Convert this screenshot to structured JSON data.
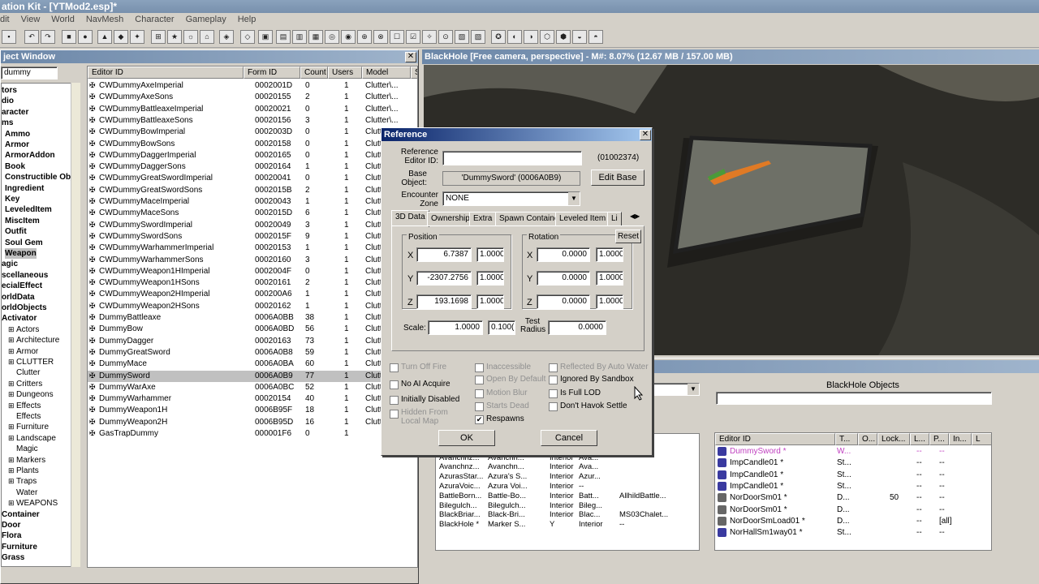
{
  "app": {
    "title": "ation Kit - [YTMod2.esp]*"
  },
  "menu": [
    "dit",
    "View",
    "World",
    "NavMesh",
    "Character",
    "Gameplay",
    "Help"
  ],
  "object_window": {
    "title": "ject Window",
    "filter": "dummy",
    "tree": [
      "tors",
      "dio",
      "aracter",
      "ms",
      "Ammo",
      "Armor",
      "ArmorAddon",
      "Book",
      "Constructible Obj",
      "Ingredient",
      "Key",
      "LeveledItem",
      "MiscItem",
      "Outfit",
      "Soul Gem",
      "Weapon",
      "agic",
      "scellaneous",
      "ecialEffect",
      "orldData",
      "orldObjects",
      "Activator",
      "Actors",
      "Architecture",
      "Armor",
      "CLUTTER",
      "Clutter",
      "Critters",
      "Dungeons",
      "Effects",
      "Effects",
      "Furniture",
      "Landscape",
      "Magic",
      "Markers",
      "Plants",
      "Traps",
      "Water",
      "WEAPONS",
      "Container",
      "Door",
      "Flora",
      "Furniture",
      "Grass"
    ],
    "columns": [
      "Editor ID",
      "Form ID",
      "Count",
      "Users",
      "Model",
      "Si"
    ],
    "rows": [
      [
        "CWDummyAxeImperial",
        "0002001D",
        "0",
        "1",
        "Clutter\\..."
      ],
      [
        "CWDummyAxeSons",
        "00020155",
        "2",
        "1",
        "Clutter\\..."
      ],
      [
        "CWDummyBattleaxeImperial",
        "00020021",
        "0",
        "1",
        "Clutter\\..."
      ],
      [
        "CWDummyBattleaxeSons",
        "00020156",
        "3",
        "1",
        "Clutter\\..."
      ],
      [
        "CWDummyBowImperial",
        "0002003D",
        "0",
        "1",
        "Clutt"
      ],
      [
        "CWDummyBowSons",
        "00020158",
        "0",
        "1",
        "Clutt"
      ],
      [
        "CWDummyDaggerImperial",
        "00020165",
        "0",
        "1",
        "Clutt"
      ],
      [
        "CWDummyDaggerSons",
        "00020164",
        "1",
        "1",
        "Clutt"
      ],
      [
        "CWDummyGreatSwordImperial",
        "00020041",
        "0",
        "1",
        "Clutt"
      ],
      [
        "CWDummyGreatSwordSons",
        "0002015B",
        "2",
        "1",
        "Clutt"
      ],
      [
        "CWDummyMaceImperial",
        "00020043",
        "1",
        "1",
        "Clutt"
      ],
      [
        "CWDummyMaceSons",
        "0002015D",
        "6",
        "1",
        "Clutt"
      ],
      [
        "CWDummySwordImperial",
        "00020049",
        "3",
        "1",
        "Clutt"
      ],
      [
        "CWDummySwordSons",
        "0002015F",
        "9",
        "1",
        "Clutt"
      ],
      [
        "CWDummyWarhammerImperial",
        "00020153",
        "1",
        "1",
        "Clutt"
      ],
      [
        "CWDummyWarhammerSons",
        "00020160",
        "3",
        "1",
        "Clutt"
      ],
      [
        "CWDummyWeapon1HImperial",
        "0002004F",
        "0",
        "1",
        "Clutt"
      ],
      [
        "CWDummyWeapon1HSons",
        "00020161",
        "2",
        "1",
        "Clutt"
      ],
      [
        "CWDummyWeapon2HImperial",
        "000200A6",
        "1",
        "1",
        "Clutt"
      ],
      [
        "CWDummyWeapon2HSons",
        "00020162",
        "1",
        "1",
        "Clutt"
      ],
      [
        "DummyBattleaxe",
        "0006A0BB",
        "38",
        "1",
        "Clutt"
      ],
      [
        "DummyBow",
        "0006A0BD",
        "56",
        "1",
        "Clutt"
      ],
      [
        "DummyDagger",
        "00020163",
        "73",
        "1",
        "Clutt"
      ],
      [
        "DummyGreatSword",
        "0006A0B8",
        "59",
        "1",
        "Clutt"
      ],
      [
        "DummyMace",
        "0006A0BA",
        "60",
        "1",
        "Clutt"
      ],
      [
        "DummySword",
        "0006A0B9",
        "77",
        "1",
        "Clutt"
      ],
      [
        "DummyWarAxe",
        "0006A0BC",
        "52",
        "1",
        "Clutt"
      ],
      [
        "DummyWarhammer",
        "00020154",
        "40",
        "1",
        "Clutt"
      ],
      [
        "DummyWeapon1H",
        "0006B95F",
        "18",
        "1",
        "Clutt"
      ],
      [
        "DummyWeapon2H",
        "0006B95D",
        "16",
        "1",
        "Clutt"
      ],
      [
        "GasTrapDummy",
        "000001F6",
        "0",
        "1",
        ""
      ]
    ]
  },
  "render_window": {
    "title": "BlackHole [Free camera, perspective] - M#: 8.07% (12.67 MB / 157.00 MB)"
  },
  "cell_view": {
    "objects_title": "BlackHole Objects",
    "left_rows": [
      [
        "AnsilvundO2",
        "Ansilvun...",
        "Interior",
        "Ansil..."
      ],
      [
        "Avanchnz...",
        "Avanchn...",
        "Interior",
        "Ava..."
      ],
      [
        "Avanchnz...",
        "Avanchn...",
        "Interior",
        "Ava..."
      ],
      [
        "Avanchnz...",
        "Avanchn...",
        "Interior",
        "Ava..."
      ],
      [
        "AzurasStar...",
        "Azura's S...",
        "Interior",
        "Azur..."
      ],
      [
        "AzuraVoic...",
        "Azura Voi...",
        "Interior",
        "--"
      ],
      [
        "BattleBorn...",
        "Battle-Bo...",
        "Interior",
        "Batt...",
        "AllhildBattle..."
      ],
      [
        "Bilegulch...",
        "Bilegulch...",
        "Interior",
        "Bileg..."
      ],
      [
        "BlackBriar...",
        "Black-Bri...",
        "Interior",
        "Blac...",
        "MS03Chalet..."
      ],
      [
        "BlackHole *",
        "Marker S...",
        "Y",
        "Interior",
        "--"
      ]
    ],
    "right_cols": [
      "Editor ID",
      "T...",
      "O...",
      "Lock...",
      "L...",
      "P...",
      "In...",
      "L"
    ],
    "right_rows": [
      [
        "DummySword *",
        "W...",
        "",
        "",
        "--",
        "--"
      ],
      [
        "ImpCandle01 *",
        "St...",
        "",
        "",
        "--",
        "--"
      ],
      [
        "ImpCandle01 *",
        "St...",
        "",
        "",
        "--",
        "--"
      ],
      [
        "ImpCandle01 *",
        "St...",
        "",
        "",
        "--",
        "--"
      ],
      [
        "NorDoorSm01 *",
        "D...",
        "",
        "50",
        "--",
        "--"
      ],
      [
        "NorDoorSm01 *",
        "D...",
        "",
        "",
        "--",
        "--"
      ],
      [
        "NorDoorSmLoad01 *",
        "D...",
        "",
        "",
        "--",
        "[all]"
      ],
      [
        "NorHallSm1way01 *",
        "St...",
        "",
        "",
        "--",
        "--"
      ]
    ]
  },
  "dialog": {
    "title": "Reference",
    "ref_editor_id_label": "Reference Editor ID:",
    "ref_editor_id": "",
    "form_id": "(01002374)",
    "base_label": "Base Object:",
    "base_value": "'DummySword' (0006A0B9)",
    "edit_base": "Edit Base",
    "zone_label": "Encounter Zone",
    "zone_value": "NONE",
    "tabs": [
      "3D Data",
      "Ownership",
      "Extra",
      "Spawn Container",
      "Leveled Item",
      "Li"
    ],
    "position_label": "Position",
    "rotation_label": "Rotation",
    "reset": "Reset",
    "pos": {
      "x": "6.7387",
      "y": "-2307.2756",
      "z": "193.1698",
      "xs": "1.0000",
      "ys": "1.0000",
      "zs": "1.0000"
    },
    "rot": {
      "x": "0.0000",
      "y": "0.0000",
      "z": "0.0000",
      "xs": "1.0000",
      "ys": "1.0000",
      "zs": "1.0000"
    },
    "scale_label": "Scale:",
    "scale": "1.0000",
    "scale2": "0.100(",
    "test_radius_label": "Test Radius",
    "test_radius": "0.0000",
    "checks": {
      "turn_off_fire": "Turn Off Fire",
      "no_ai_acquire": "No AI Acquire",
      "initially_disabled": "Initially Disabled",
      "hidden_from_local_map": "Hidden From Local Map",
      "inaccessible": "Inaccessible",
      "open_by_default": "Open By Default",
      "motion_blur": "Motion Blur",
      "starts_dead": "Starts Dead",
      "respawns": "Respawns",
      "reflected": "Reflected By Auto Water",
      "ignored_by_sandbox": "Ignored By Sandbox",
      "is_full_lod": "Is Full LOD",
      "dont_havok": "Don't Havok Settle"
    },
    "ok": "OK",
    "cancel": "Cancel"
  },
  "axis": {
    "x": "X",
    "y": "Y",
    "z": "Z"
  },
  "close_glyph": "✕"
}
